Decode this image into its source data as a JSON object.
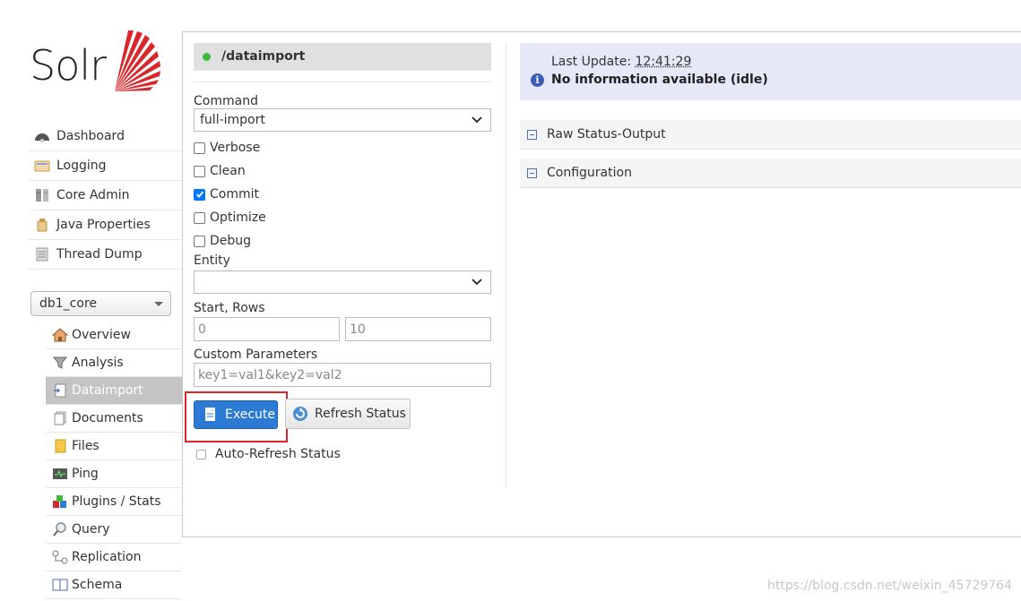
{
  "logo": {
    "text": "Solr"
  },
  "nav": {
    "items": [
      {
        "label": "Dashboard",
        "icon": "dashboard-icon"
      },
      {
        "label": "Logging",
        "icon": "logging-icon"
      },
      {
        "label": "Core Admin",
        "icon": "core-admin-icon"
      },
      {
        "label": "Java Properties",
        "icon": "java-properties-icon"
      },
      {
        "label": "Thread Dump",
        "icon": "thread-dump-icon"
      }
    ],
    "core_selector": "db1_core",
    "core_items": [
      {
        "label": "Overview",
        "icon": "home-icon"
      },
      {
        "label": "Analysis",
        "icon": "funnel-icon"
      },
      {
        "label": "Dataimport",
        "icon": "dataimport-icon",
        "active": true
      },
      {
        "label": "Documents",
        "icon": "documents-icon"
      },
      {
        "label": "Files",
        "icon": "folder-icon"
      },
      {
        "label": "Ping",
        "icon": "ping-icon"
      },
      {
        "label": "Plugins / Stats",
        "icon": "plugins-icon"
      },
      {
        "label": "Query",
        "icon": "magnifier-icon"
      },
      {
        "label": "Replication",
        "icon": "replication-icon"
      },
      {
        "label": "Schema",
        "icon": "schema-icon"
      }
    ]
  },
  "dataimport": {
    "header": "/dataimport",
    "command_label": "Command",
    "command_value": "full-import",
    "options": [
      {
        "label": "Verbose",
        "checked": false
      },
      {
        "label": "Clean",
        "checked": false
      },
      {
        "label": "Commit",
        "checked": true
      },
      {
        "label": "Optimize",
        "checked": false
      },
      {
        "label": "Debug",
        "checked": false
      }
    ],
    "entity_label": "Entity",
    "entity_value": "",
    "start_rows_label": "Start, Rows",
    "start_value": "0",
    "rows_value": "10",
    "custom_params_label": "Custom Parameters",
    "custom_params_value": "key1=val1&key2=val2",
    "execute_label": "Execute",
    "refresh_label": "Refresh Status",
    "auto_refresh_label": "Auto-Refresh Status"
  },
  "status": {
    "last_update_label": "Last Update:",
    "last_update_time": "12:41:29",
    "message": "No information available (idle)",
    "sections": [
      "Raw Status-Output",
      "Configuration"
    ]
  },
  "watermark": "https://blog.csdn.net/weixin_45729764",
  "colors": {
    "accent": "#2b7bd4",
    "highlight": "#d9282c",
    "info_bg": "#e6e8f7",
    "status_ok": "#3dbb3d"
  }
}
